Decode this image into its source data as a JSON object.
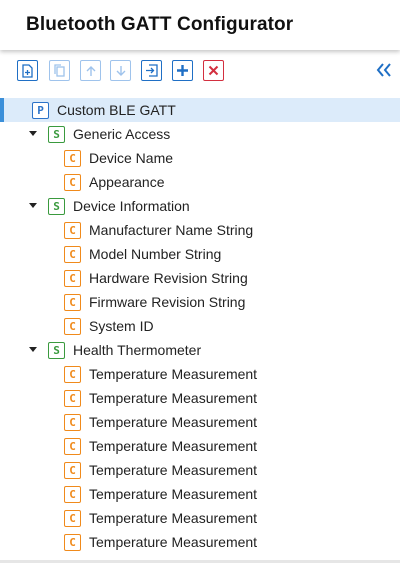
{
  "header": {
    "title": "Bluetooth GATT Configurator"
  },
  "toolbar": {
    "buttons": [
      {
        "icon": "add-file-icon",
        "state": "enabled"
      },
      {
        "icon": "copy-icon",
        "state": "disabled"
      },
      {
        "icon": "arrow-up-icon",
        "state": "disabled"
      },
      {
        "icon": "arrow-down-icon",
        "state": "disabled"
      },
      {
        "icon": "import-icon",
        "state": "enabled"
      },
      {
        "icon": "plus-icon",
        "state": "enabled"
      },
      {
        "icon": "close-icon",
        "state": "danger"
      }
    ],
    "collapse_icon": "double-chevron-left-icon"
  },
  "colors": {
    "primary": "#1f6fc5",
    "danger": "#d32f3f",
    "profile_badge": "#2a72c8",
    "service_badge": "#3a9a3e",
    "characteristic_badge": "#f08a1b",
    "selected_row": "#dcebfa"
  },
  "tree": {
    "profile": {
      "badge": "P",
      "label": "Custom BLE GATT"
    },
    "services": [
      {
        "badge": "S",
        "label": "Generic Access",
        "expanded": true,
        "characteristics": [
          {
            "badge": "C",
            "label": "Device Name"
          },
          {
            "badge": "C",
            "label": "Appearance"
          }
        ]
      },
      {
        "badge": "S",
        "label": "Device Information",
        "expanded": true,
        "characteristics": [
          {
            "badge": "C",
            "label": "Manufacturer Name String"
          },
          {
            "badge": "C",
            "label": "Model Number String"
          },
          {
            "badge": "C",
            "label": "Hardware Revision String"
          },
          {
            "badge": "C",
            "label": "Firmware Revision String"
          },
          {
            "badge": "C",
            "label": "System ID"
          }
        ]
      },
      {
        "badge": "S",
        "label": "Health Thermometer",
        "expanded": true,
        "characteristics": [
          {
            "badge": "C",
            "label": "Temperature Measurement"
          },
          {
            "badge": "C",
            "label": "Temperature Measurement"
          },
          {
            "badge": "C",
            "label": "Temperature Measurement"
          },
          {
            "badge": "C",
            "label": "Temperature Measurement"
          },
          {
            "badge": "C",
            "label": "Temperature Measurement"
          },
          {
            "badge": "C",
            "label": "Temperature Measurement"
          },
          {
            "badge": "C",
            "label": "Temperature Measurement"
          },
          {
            "badge": "C",
            "label": "Temperature Measurement"
          }
        ]
      }
    ]
  }
}
